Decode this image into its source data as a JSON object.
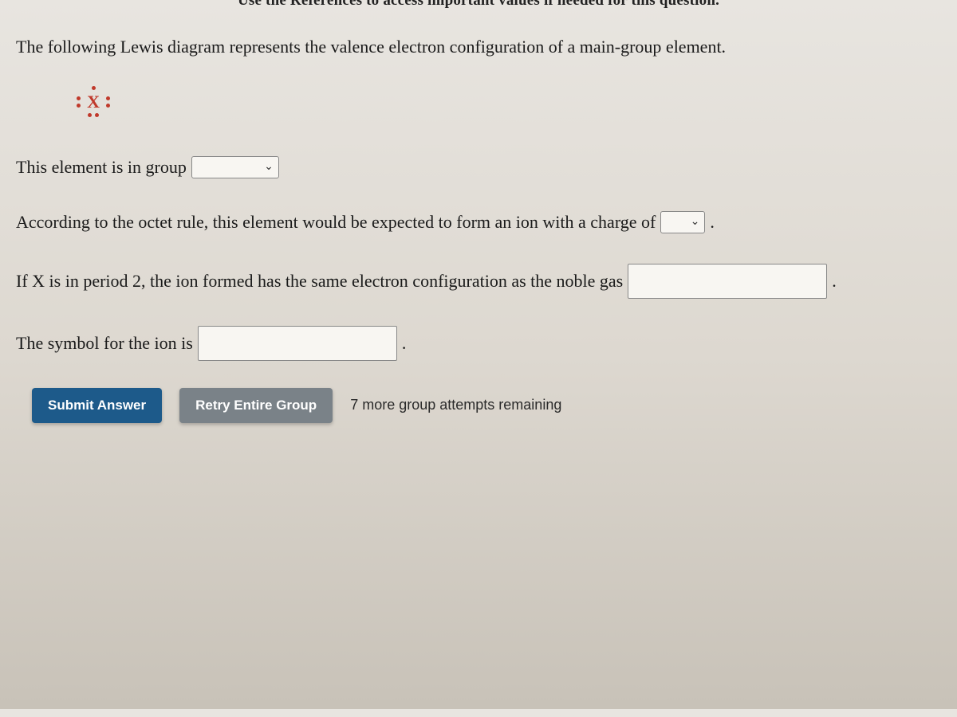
{
  "header_cut": "Use the References to access important values if needed for this question.",
  "intro": "The following Lewis diagram represents the valence electron configuration of a main-group element.",
  "lewis_symbol": "X",
  "q1_prefix": "This element is in group",
  "q2_prefix": "According to the octet rule, this element would be expected to form an ion with a charge of",
  "q3_prefix": "If X is in period 2, the ion formed has the same electron configuration as the noble gas",
  "q4_prefix": "The symbol for the ion is",
  "period": ".",
  "buttons": {
    "submit": "Submit Answer",
    "retry": "Retry Entire Group"
  },
  "attempts_text": "7 more group attempts remaining"
}
